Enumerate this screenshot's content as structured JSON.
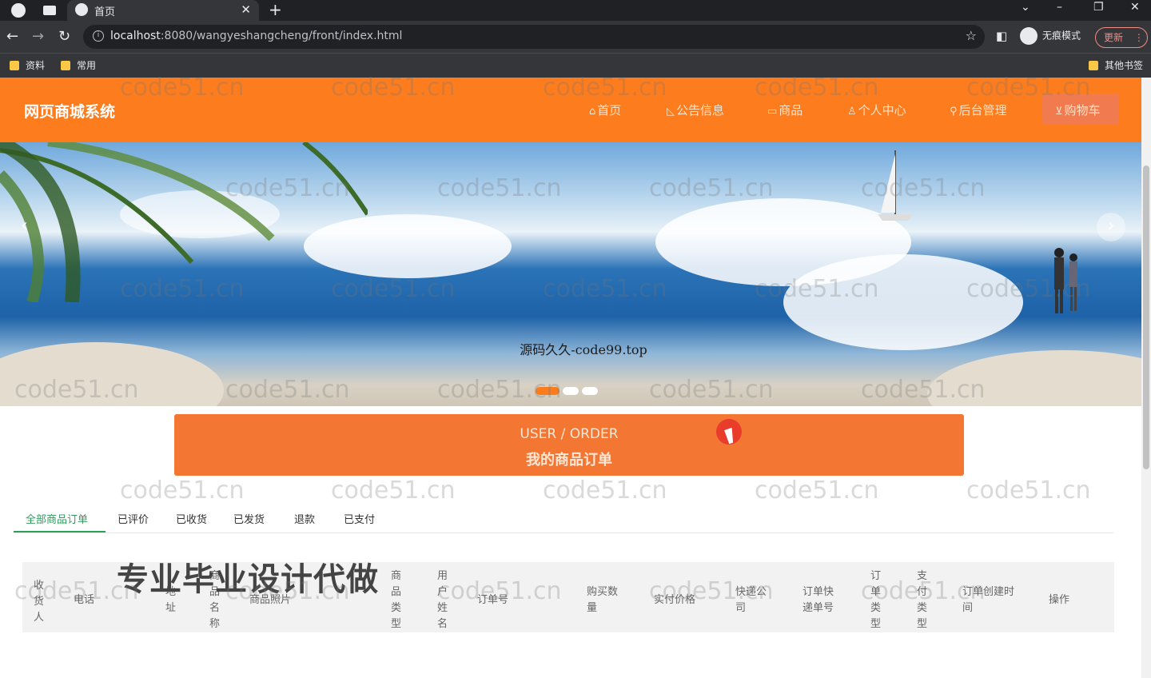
{
  "browser": {
    "tab_title": "首页",
    "url_host": "localhost",
    "url_rest": ":8080/wangyeshangcheng/front/index.html",
    "incognito_label": "无痕模式",
    "update_label": "更新",
    "bookmarks": [
      "资料",
      "常用"
    ],
    "other_bookmarks": "其他书签"
  },
  "header": {
    "site_title": "网页商城系统",
    "nav": [
      {
        "label": "首页",
        "icon": "home-icon"
      },
      {
        "label": "公告信息",
        "icon": "announce-icon"
      },
      {
        "label": "商品",
        "icon": "shop-icon"
      },
      {
        "label": "个人中心",
        "icon": "user-icon"
      },
      {
        "label": "后台管理",
        "icon": "link-icon"
      },
      {
        "label": "购物车",
        "icon": "cart-icon"
      }
    ]
  },
  "banner": {
    "caption": "源码久久-code99.top",
    "slide_count": 3,
    "active_slide": 1
  },
  "section": {
    "title_en": "USER / ORDER",
    "title_cn": "我的商品订单"
  },
  "order_tabs": [
    "全部商品订单",
    "已评价",
    "已收货",
    "已发货",
    "退款",
    "已支付"
  ],
  "table_headers": [
    "收货人",
    "电话",
    "地址",
    "商品名称",
    "商品照片",
    "商品类型",
    "用户姓名",
    "订单号",
    "购买数量",
    "实付价格",
    "快递公司",
    "订单快递单号",
    "订单类型",
    "支付类型",
    "订单创建时间",
    "操作"
  ],
  "overlay_text": "专业毕业设计代做",
  "watermark": "code51.cn",
  "colors": {
    "brand_orange": "#fc7c1e",
    "title_bar": "#f37633",
    "active_tab": "#2e9e5b"
  }
}
